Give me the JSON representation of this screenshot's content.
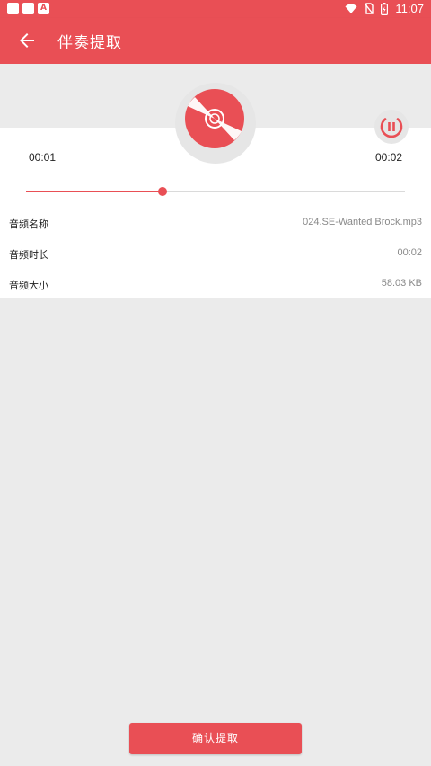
{
  "status_bar": {
    "time": "11:07",
    "left_icons": [
      "app-square-icon",
      "app-square-icon",
      "android-a-icon"
    ],
    "right_icons": [
      "wifi-icon",
      "no-sim-icon",
      "battery-icon"
    ],
    "a_label": "A"
  },
  "app_bar": {
    "title": "伴奏提取",
    "back_icon": "arrow-left-icon"
  },
  "player": {
    "current_time": "00:01",
    "total_time": "00:02",
    "progress_fraction": 0.36,
    "disc_icon": "disc-icon",
    "pause_icon": "pause-icon"
  },
  "info": [
    {
      "label": "音频名称",
      "value": "024.SE-Wanted Brock.mp3"
    },
    {
      "label": "音频时长",
      "value": "00:02"
    },
    {
      "label": "音频大小",
      "value": "58.03 KB"
    }
  ],
  "confirm_label": "确认提取",
  "colors": {
    "accent": "#e94f55",
    "background": "#ebebeb",
    "card": "#ffffff"
  }
}
